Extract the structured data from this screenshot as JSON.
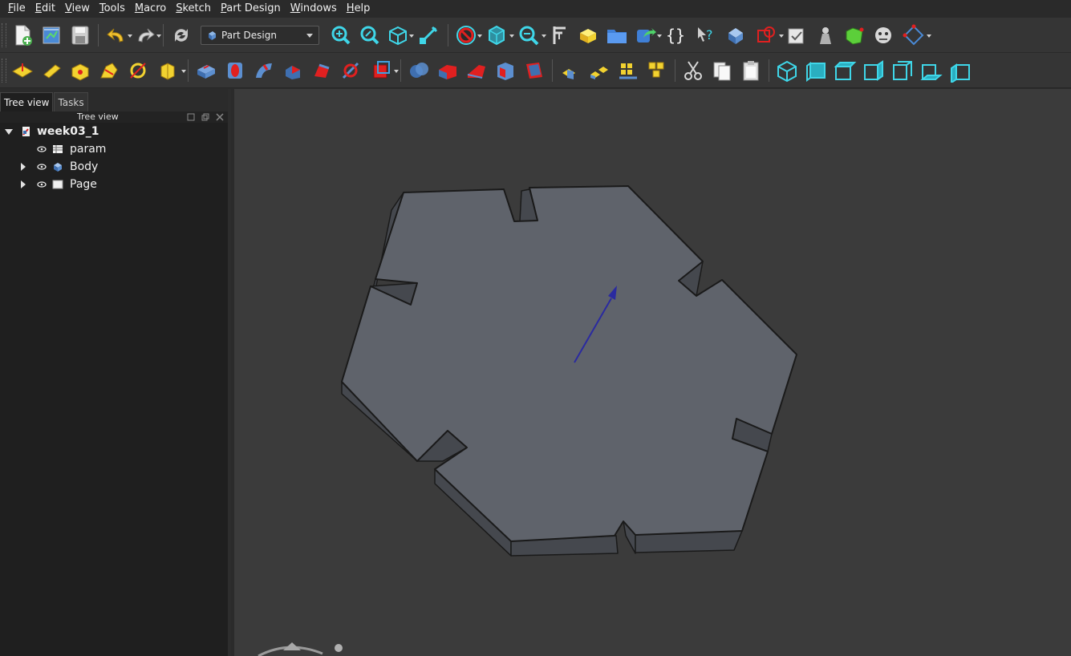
{
  "menu": {
    "items": [
      {
        "label": "File",
        "key": "F",
        "rest": "ile"
      },
      {
        "label": "Edit",
        "key": "E",
        "rest": "dit"
      },
      {
        "label": "View",
        "key": "V",
        "rest": "iew"
      },
      {
        "label": "Tools",
        "key": "T",
        "rest": "ools"
      },
      {
        "label": "Macro",
        "key": "M",
        "rest": "acro"
      },
      {
        "label": "Sketch",
        "key": "S",
        "rest": "ketch"
      },
      {
        "label": "Part Design",
        "key": "P",
        "rest": "art Design"
      },
      {
        "label": "Windows",
        "key": "W",
        "rest": "indows"
      },
      {
        "label": "Help",
        "key": "H",
        "rest": "elp"
      }
    ]
  },
  "toolbar": {
    "workbench_selected": "Part Design"
  },
  "panel": {
    "tabs": [
      {
        "label": "Tree view",
        "active": true
      },
      {
        "label": "Tasks",
        "active": false
      }
    ],
    "header_title": "Tree view"
  },
  "tree": {
    "document": "week03_1",
    "items": [
      {
        "label": "param",
        "icon": "spreadsheet-icon",
        "expandable": false
      },
      {
        "label": "Body",
        "icon": "body-icon",
        "expandable": true
      },
      {
        "label": "Page",
        "icon": "page-icon",
        "expandable": true
      }
    ]
  },
  "colors": {
    "background": "#3b3b3b",
    "face": "#5f636b",
    "side": "#4a4d53",
    "edge": "#1a1a1a",
    "axis": "#2a2aa0",
    "cyan": "#3fd6e8",
    "yellow": "#f2d230",
    "red": "#d62a2a"
  }
}
